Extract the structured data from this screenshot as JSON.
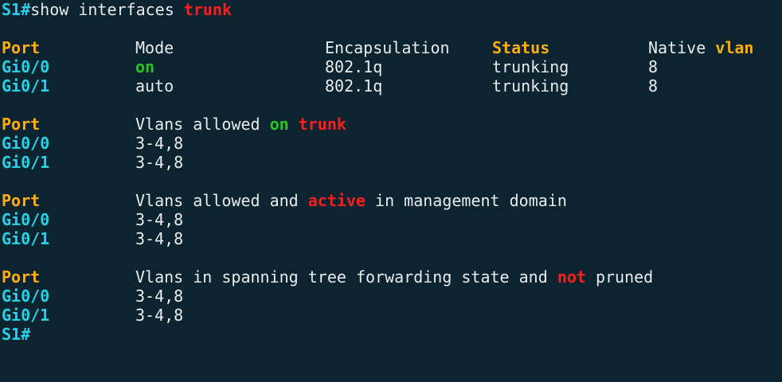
{
  "prompt": "S1#",
  "command": {
    "text": "show interfaces ",
    "keyword": "trunk"
  },
  "mode_table": {
    "headers": {
      "port": "Port",
      "mode": "Mode",
      "encapsulation": "Encapsulation",
      "status": "Status",
      "native": "Native ",
      "vlan": "vlan"
    },
    "rows": [
      {
        "port": "Gi0/0",
        "mode": "on",
        "encapsulation": "802.1q",
        "status": "trunking",
        "native_vlan": "8"
      },
      {
        "port": "Gi0/1",
        "mode": "auto",
        "encapsulation": "802.1q",
        "status": "trunking",
        "native_vlan": "8"
      }
    ]
  },
  "allowed_section": {
    "port_header": "Port",
    "title_pre": "Vlans allowed ",
    "title_on": "on",
    "title_space": " ",
    "title_trunk": "trunk",
    "rows": [
      {
        "port": "Gi0/0",
        "vlans": "3-4,8"
      },
      {
        "port": "Gi0/1",
        "vlans": "3-4,8"
      }
    ]
  },
  "active_section": {
    "port_header": "Port",
    "title_pre": "Vlans allowed and ",
    "title_active": "active",
    "title_post": " in management domain",
    "rows": [
      {
        "port": "Gi0/0",
        "vlans": "3-4,8"
      },
      {
        "port": "Gi0/1",
        "vlans": "3-4,8"
      }
    ]
  },
  "stp_section": {
    "port_header": "Port",
    "title_pre": "Vlans in spanning tree forwarding state and ",
    "title_not": "not",
    "title_post": " pruned",
    "rows": [
      {
        "port": "Gi0/0",
        "vlans": "3-4,8"
      },
      {
        "port": "Gi0/1",
        "vlans": "3-4,8"
      }
    ]
  },
  "final_prompt": "S1#",
  "colors": {
    "background": "#0b2430",
    "port": "#27d0e6",
    "header": "#ffae18",
    "on": "#27c424",
    "highlight": "#ff1e1e",
    "text": "#e8ecee"
  }
}
